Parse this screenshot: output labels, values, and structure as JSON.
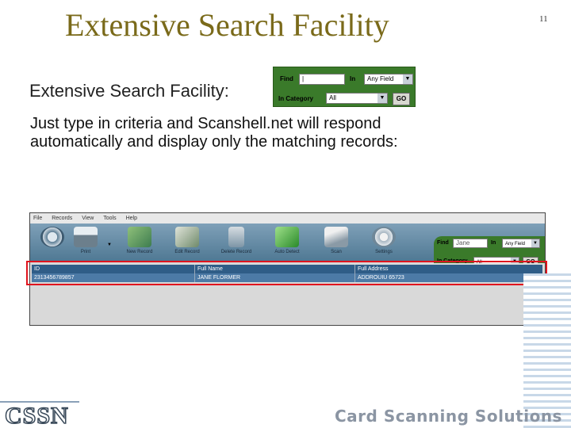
{
  "slide": {
    "title": "Extensive Search Facility",
    "page_number": "11",
    "subhead": "Extensive Search Facility:",
    "body": "Just type in criteria and Scanshell.net will respond automatically and display only the matching records:"
  },
  "mini_search": {
    "find_label": "Find",
    "find_value": "|",
    "in_label": "In",
    "in_value": "Any Field",
    "category_label": "In Category",
    "category_value": "All",
    "go_label": "GO"
  },
  "app": {
    "menu": [
      "File",
      "Records",
      "View",
      "Tools",
      "Help"
    ],
    "toolbar": [
      {
        "label": "",
        "icon": "scan-wheel-icon"
      },
      {
        "label": "Print",
        "icon": "printer-icon"
      },
      {
        "label": "New Record",
        "icon": "new-record-icon"
      },
      {
        "label": "Edit Record",
        "icon": "edit-record-icon"
      },
      {
        "label": "Delete Record",
        "icon": "trash-icon"
      },
      {
        "label": "Auto Detect",
        "icon": "auto-detect-icon"
      },
      {
        "label": "Scan",
        "icon": "scanner-icon"
      },
      {
        "label": "Settings",
        "icon": "gears-icon"
      }
    ],
    "search": {
      "find_label": "Find",
      "find_value": "Jane",
      "in_label": "In",
      "in_value": "Any Field",
      "category_label": "In Category",
      "category_value": "All",
      "go_label": "GO"
    },
    "table": {
      "columns": [
        "ID",
        "Full Name",
        "Full Address"
      ],
      "rows": [
        [
          "2313456789857",
          "JANE FLORMER",
          "ADDROUIU 65723"
        ]
      ]
    }
  },
  "footer": {
    "logo": "CSSN",
    "tagline": "Card Scanning Solutions"
  },
  "colors": {
    "title": "#7a6a1a",
    "toolbar": "#5e87a2",
    "search_panel": "#3a7a2a",
    "grid_header": "#2f5d87",
    "highlight": "#e0141e"
  }
}
